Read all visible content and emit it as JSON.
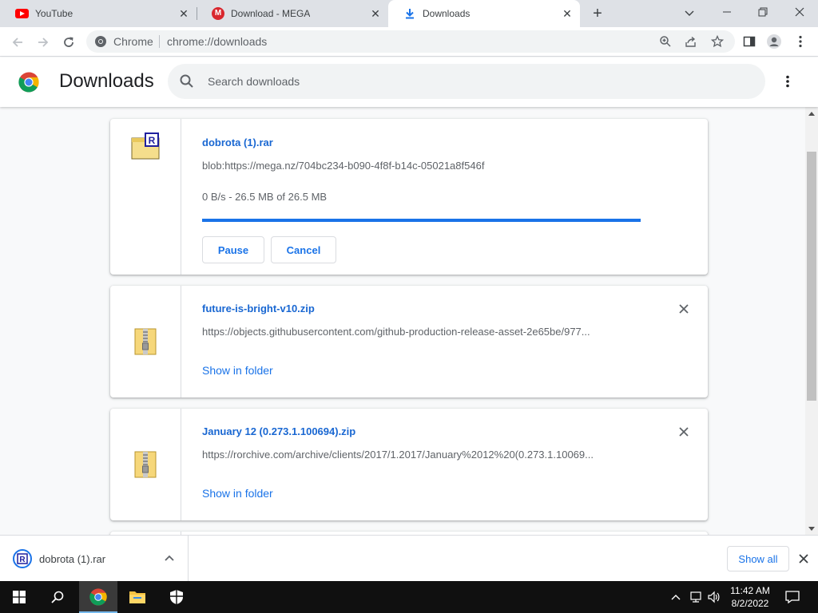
{
  "tabs": [
    {
      "title": "YouTube",
      "icon": "youtube-icon",
      "active": false
    },
    {
      "title": "Download - MEGA",
      "icon": "mega-icon",
      "active": false
    },
    {
      "title": "Downloads",
      "icon": "download-icon",
      "active": true
    }
  ],
  "omnibox": {
    "chip": "Chrome",
    "url": "chrome://downloads"
  },
  "page": {
    "title": "Downloads",
    "search_placeholder": "Search downloads"
  },
  "downloads": [
    {
      "name": "dobrota (1).rar",
      "url": "blob:https://mega.nz/704bc234-b090-4f8f-b14c-05021a8f546f",
      "status": "0 B/s - 26.5 MB of 26.5 MB",
      "progress": 1.0,
      "pause_label": "Pause",
      "cancel_label": "Cancel",
      "icon": "rar-archive-icon"
    },
    {
      "name": "future-is-bright-v10.zip",
      "url": "https://objects.githubusercontent.com/github-production-release-asset-2e65be/977...",
      "link": "Show in folder",
      "icon": "zip-archive-icon"
    },
    {
      "name": "January 12 (0.273.1.100694).zip",
      "url": "https://rorchive.com/archive/clients/2017/1.2017/January%2012%20(0.273.1.10069...",
      "link": "Show in folder",
      "icon": "zip-archive-icon"
    }
  ],
  "shelf": {
    "item_name": "dobrota (1).rar",
    "show_all": "Show all"
  },
  "taskbar": {
    "time": "11:42 AM",
    "date": "8/2/2022"
  },
  "colors": {
    "accent": "#1a73e8",
    "tabstrip": "#dee1e6",
    "taskbar": "#101010"
  }
}
